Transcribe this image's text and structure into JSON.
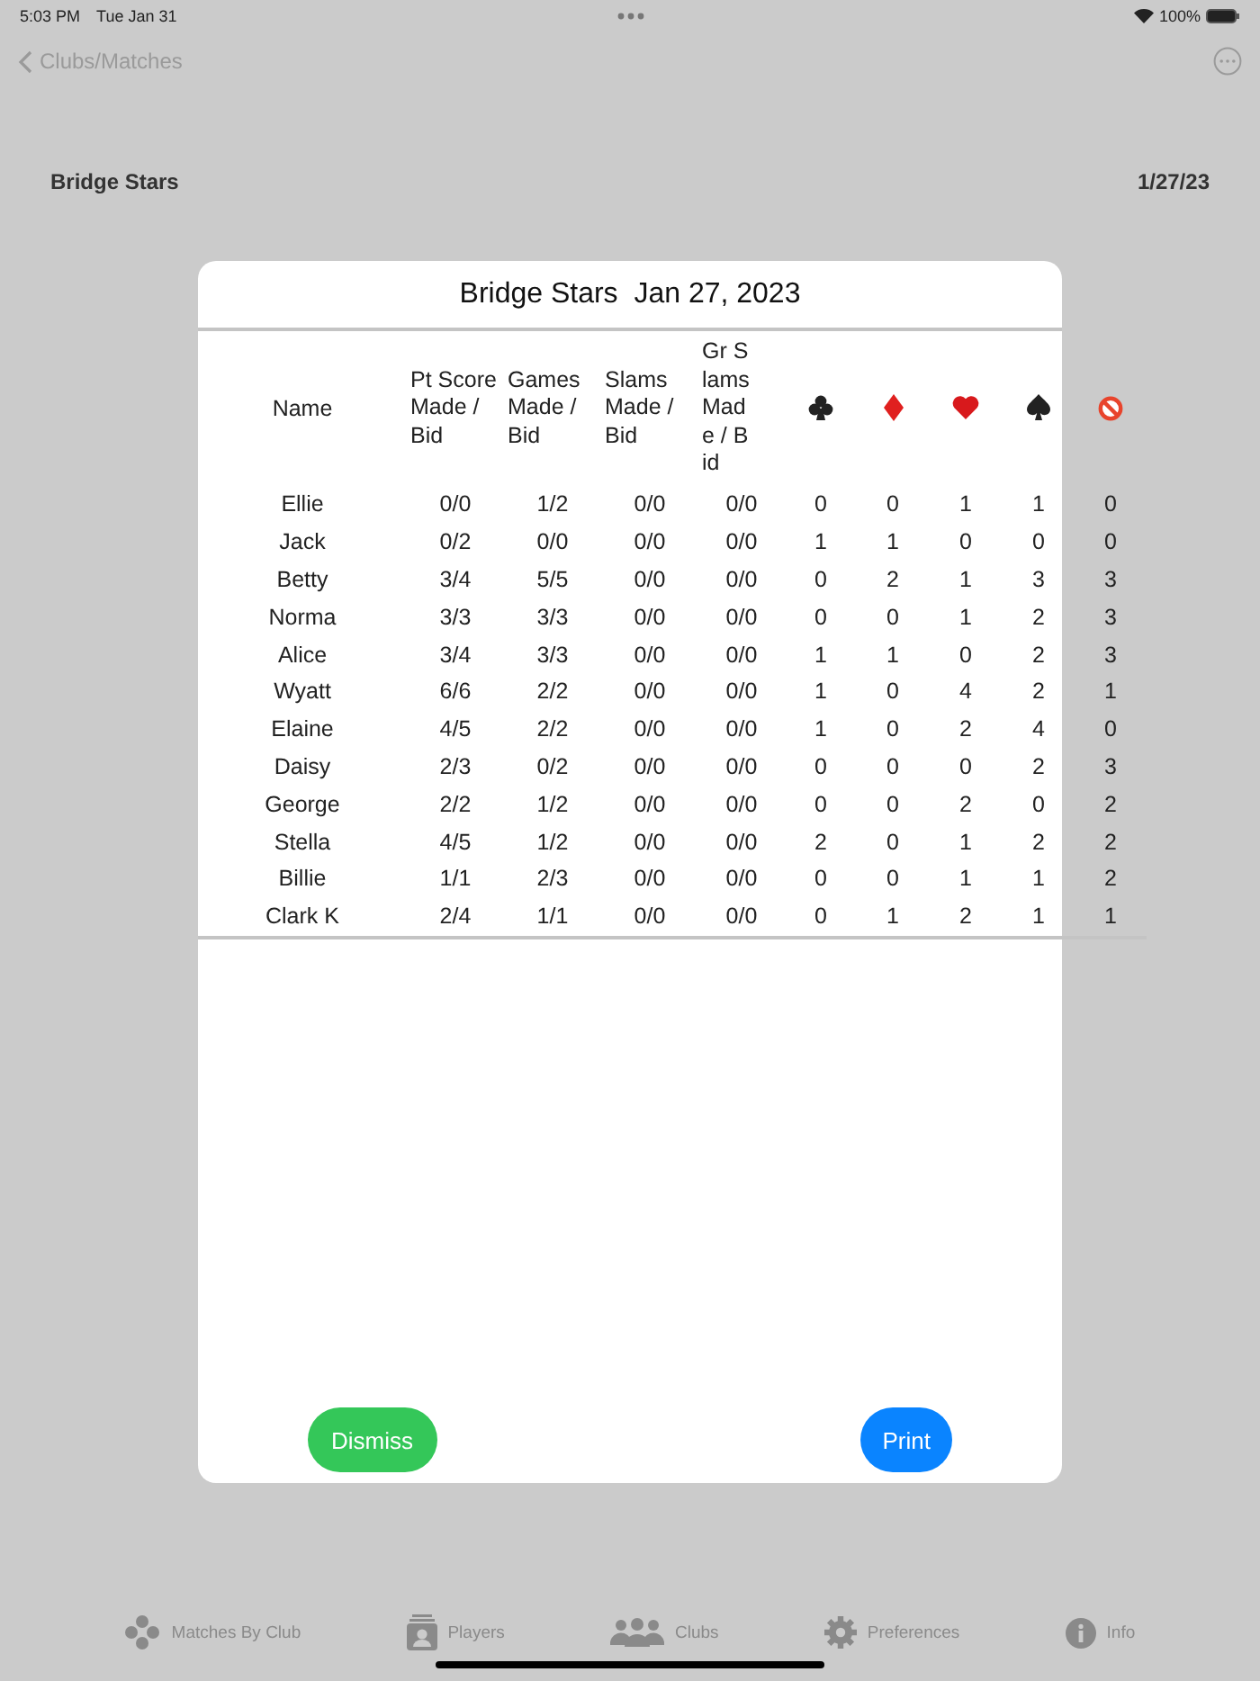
{
  "status_bar": {
    "time": "5:03 PM",
    "date": "Tue Jan 31",
    "battery": "100%"
  },
  "nav": {
    "back": "Clubs/Matches"
  },
  "header": {
    "title": "Bridge Stars",
    "date": "1/27/23"
  },
  "modal": {
    "title": "Bridge Stars  Jan 27, 2023",
    "columns": [
      {
        "kind": "text",
        "label": "Name"
      },
      {
        "kind": "text",
        "label": "Pt Score Made / Bid"
      },
      {
        "kind": "text",
        "label": "Games Made / Bid"
      },
      {
        "kind": "text",
        "label": "Slams Made / Bid"
      },
      {
        "kind": "text",
        "label": "Gr Slams Made / Bid"
      },
      {
        "kind": "club"
      },
      {
        "kind": "diamond"
      },
      {
        "kind": "heart"
      },
      {
        "kind": "spade"
      },
      {
        "kind": "notrump"
      }
    ],
    "rows": [
      [
        "Ellie",
        "0/0",
        "1/2",
        "0/0",
        "0/0",
        "0",
        "0",
        "1",
        "1",
        "0"
      ],
      [
        "Jack",
        "0/2",
        "0/0",
        "0/0",
        "0/0",
        "1",
        "1",
        "0",
        "0",
        "0"
      ],
      [
        "Betty",
        "3/4",
        "5/5",
        "0/0",
        "0/0",
        "0",
        "2",
        "1",
        "3",
        "3"
      ],
      [
        "Norma",
        "3/3",
        "3/3",
        "0/0",
        "0/0",
        "0",
        "0",
        "1",
        "2",
        "3"
      ],
      [
        "Alice",
        "3/4",
        "3/3",
        "0/0",
        "0/0",
        "1",
        "1",
        "0",
        "2",
        "3"
      ],
      [
        "Wyatt",
        "6/6",
        "2/2",
        "0/0",
        "0/0",
        "1",
        "0",
        "4",
        "2",
        "1"
      ],
      [
        "Elaine",
        "4/5",
        "2/2",
        "0/0",
        "0/0",
        "1",
        "0",
        "2",
        "4",
        "0"
      ],
      [
        "Daisy",
        "2/3",
        "0/2",
        "0/0",
        "0/0",
        "0",
        "0",
        "0",
        "2",
        "3"
      ],
      [
        "George",
        "2/2",
        "1/2",
        "0/0",
        "0/0",
        "0",
        "0",
        "2",
        "0",
        "2"
      ],
      [
        "Stella",
        "4/5",
        "1/2",
        "0/0",
        "0/0",
        "2",
        "0",
        "1",
        "2",
        "2"
      ],
      [
        "Billie",
        "1/1",
        "2/3",
        "0/0",
        "0/0",
        "0",
        "0",
        "1",
        "1",
        "2"
      ],
      [
        "Clark K",
        "2/4",
        "1/1",
        "0/0",
        "0/0",
        "0",
        "1",
        "2",
        "1",
        "1"
      ]
    ],
    "buttons": [
      {
        "kind": "dismiss",
        "label": "Dismiss"
      },
      {
        "kind": "print",
        "label": "Print"
      }
    ]
  },
  "tab_bar": [
    {
      "label": "Matches By Club"
    },
    {
      "label": "Players"
    },
    {
      "label": "Clubs"
    },
    {
      "label": "Preferences"
    },
    {
      "label": "Info"
    }
  ]
}
